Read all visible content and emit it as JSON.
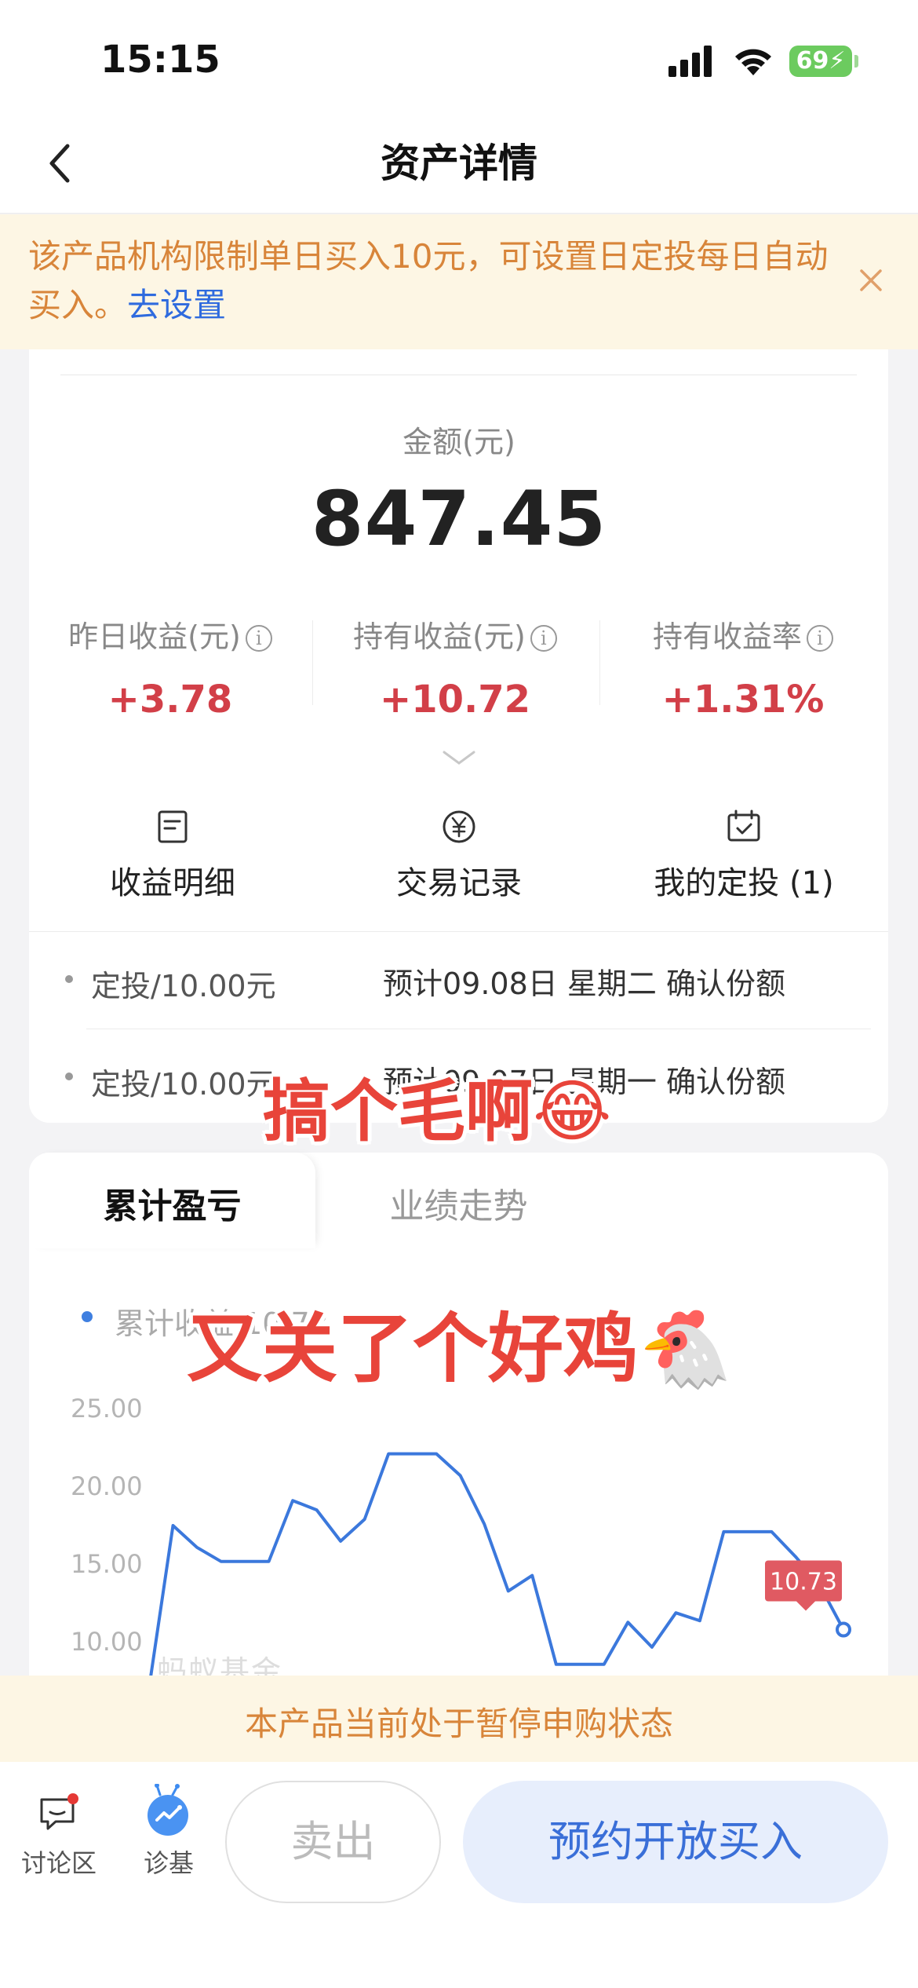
{
  "status_bar": {
    "time": "15:15",
    "battery": "69"
  },
  "nav": {
    "title": "资产详情"
  },
  "notice": {
    "text": "该产品机构限制单日买入10元，可设置日定投每日自动买入。",
    "link": "去设置"
  },
  "summary": {
    "amount_label": "金额(元)",
    "amount": "847.45",
    "stats": [
      {
        "label": "昨日收益(元)",
        "value": "+3.78"
      },
      {
        "label": "持有收益(元)",
        "value": "+10.72"
      },
      {
        "label": "持有收益率",
        "value": "+1.31%"
      }
    ]
  },
  "actions": [
    {
      "label": "收益明细",
      "icon": "document-icon"
    },
    {
      "label": "交易记录",
      "icon": "yuan-icon"
    },
    {
      "label": "我的定投 (1)",
      "icon": "calendar-check-icon"
    }
  ],
  "plans": [
    {
      "name": "定投/10.00元",
      "detail": "预计09.08日 星期二 确认份额"
    },
    {
      "name": "定投/10.00元",
      "detail": "预计09.07日 星期一 确认份额"
    }
  ],
  "chart_tabs": {
    "active": "累计盈亏",
    "other": "业绩走势"
  },
  "chart_data": {
    "type": "line",
    "legend": "累计收益 10.73",
    "y_ticks": [
      "25.00",
      "20.00",
      "15.00",
      "10.00"
    ],
    "ylim": [
      5.5,
      26.5
    ],
    "x": [
      0,
      1,
      2,
      3,
      4,
      5,
      6,
      7,
      8,
      9,
      10,
      11,
      12,
      13,
      14,
      15,
      16,
      17,
      18,
      19,
      20,
      21,
      22,
      23,
      24,
      25,
      26,
      27,
      28,
      29
    ],
    "values": [
      7.0,
      17.4,
      16.0,
      15.1,
      15.1,
      15.1,
      19.0,
      18.4,
      16.4,
      17.8,
      22.0,
      22.0,
      22.0,
      20.6,
      17.5,
      13.2,
      14.2,
      8.5,
      8.5,
      8.5,
      11.2,
      9.6,
      11.8,
      11.3,
      17.0,
      17.0,
      17.0,
      15.4,
      13.6,
      10.73
    ],
    "last_label": "10.73",
    "watermark": "蚂蚁基金",
    "color": "#3b78dc"
  },
  "stickers": {
    "line1": "搞个毛啊😂",
    "line2": "又关了个好鸡🐔"
  },
  "suspend_notice": "本产品当前处于暂停申购状态",
  "bottom_bar": {
    "discuss": "讨论区",
    "diagnose": "诊基",
    "sell": "卖出",
    "buy": "预约开放买入"
  }
}
